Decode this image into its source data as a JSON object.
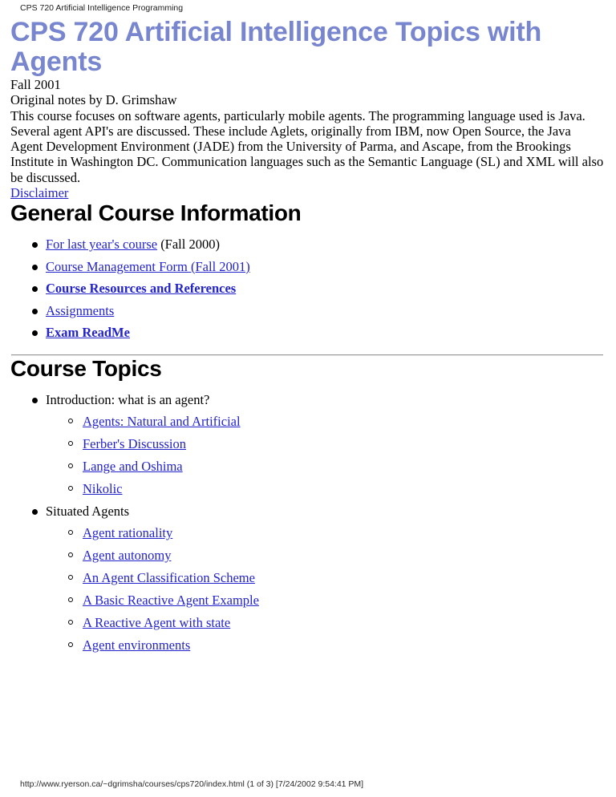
{
  "print": {
    "header": "CPS 720 Artificial Intelligence Programming",
    "footer": "http://www.ryerson.ca/~dgrimsha/courses/cps720/index.html (1 of 3) [7/24/2002 9:54:41 PM]"
  },
  "colors": {
    "title": "#7886cf",
    "link": "#2323cc",
    "text": "#000000",
    "background": "#ffffff",
    "rule": "#8c8c8c"
  },
  "document": {
    "title": "CPS 720 Artificial Intelligence Topics with Agents",
    "term": "Fall 2001",
    "attribution": "Original notes by D. Grimshaw",
    "description": "This course focuses on software agents, particularly mobile agents. The programming language used is Java. Several agent API's are discussed. These include Aglets, originally from IBM, now Open Source, the Java Agent Development Environment (JADE) from the University of Parma, and Ascape, from the Brookings Institute in Washington DC. Communication languages such as the Semantic Language (SL) and XML will also be discussed.",
    "disclaimer_link": "Disclaimer"
  },
  "general_info": {
    "heading": "General Course Information",
    "items": [
      {
        "link": "For last year's course",
        "suffix": " (Fall 2000)",
        "bold": false
      },
      {
        "link": "Course Management Form (Fall 2001)",
        "suffix": "",
        "bold": false
      },
      {
        "link": "Course Resources and References",
        "suffix": "",
        "bold": true
      },
      {
        "link": "Assignments",
        "suffix": "",
        "bold": false
      },
      {
        "link": "Exam ReadMe",
        "suffix": "",
        "bold": true
      }
    ]
  },
  "course_topics": {
    "heading": "Course Topics",
    "groups": [
      {
        "label": "Introduction: what is an agent?",
        "subitems": [
          "Agents: Natural and Artificial",
          "Ferber's Discussion",
          "Lange and Oshima",
          "Nikolic"
        ]
      },
      {
        "label": "Situated Agents",
        "subitems": [
          "Agent rationality",
          "Agent autonomy",
          "An Agent Classification Scheme",
          "A Basic Reactive Agent Example",
          "A Reactive Agent with state",
          "Agent environments"
        ]
      }
    ]
  }
}
